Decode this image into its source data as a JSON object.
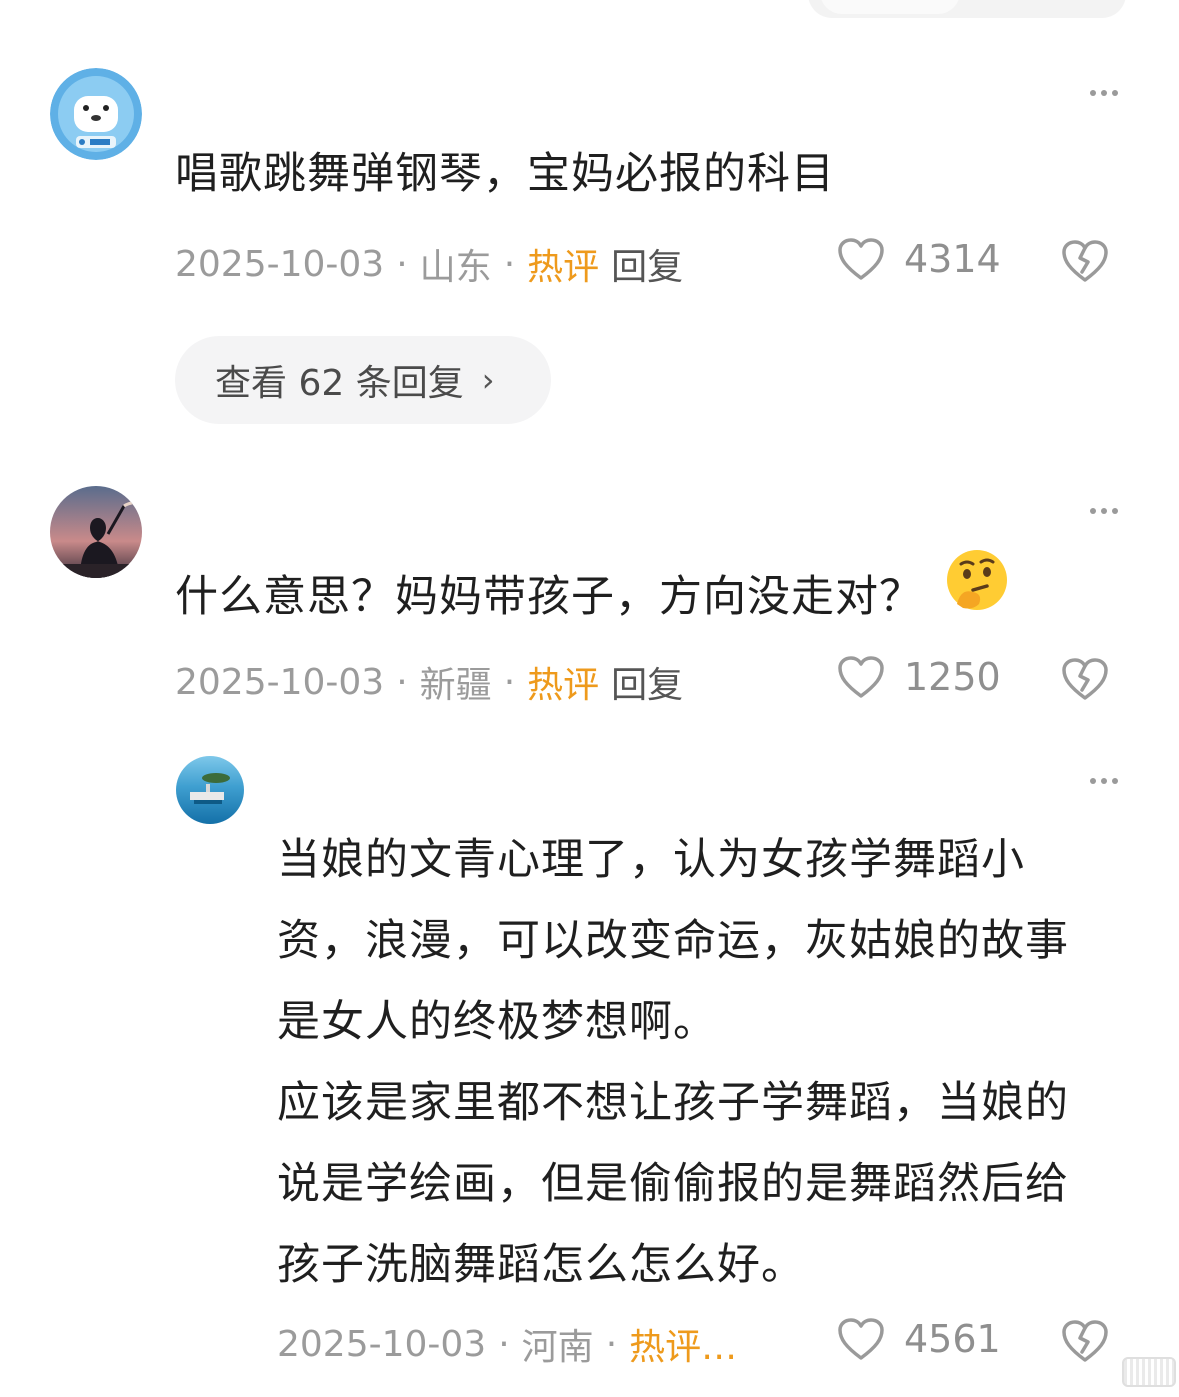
{
  "comments": [
    {
      "text": "唱歌跳舞弹钢琴，宝妈必报的科目",
      "date": "2025-10-03",
      "location": "山东",
      "tag": "热评",
      "reply_label": "回复",
      "likes": "4314",
      "view_replies": "查看 62 条回复",
      "view_replies_chevron": "›"
    },
    {
      "text": "什么意思？妈妈带孩子，方向没走对？",
      "date": "2025-10-03",
      "location": "新疆",
      "tag": "热评",
      "reply_label": "回复",
      "likes": "1250"
    },
    {
      "text_lines": [
        "当娘的文青心理了，认为女孩学舞蹈小",
        "资，浪漫，可以改变命运，灰姑娘的故事",
        "是女人的终极梦想啊。",
        "应该是家里都不想让孩子学舞蹈，当娘的",
        "说是学绘画，但是偷偷报的是舞蹈然后给",
        "孩子洗脑舞蹈怎么怎么好。"
      ],
      "date": "2025-10-03",
      "location": "河南",
      "tag": "热评…",
      "likes": "4561"
    }
  ],
  "separator": "·",
  "icons": {
    "like": "heart-icon",
    "dislike": "broken-heart-icon",
    "more": "more-dots-icon",
    "emoji": "thinking-face-emoji"
  },
  "colors": {
    "hot_tag": "#ee9a1c",
    "meta": "#9b9b9b",
    "text": "#1f1f1f"
  }
}
